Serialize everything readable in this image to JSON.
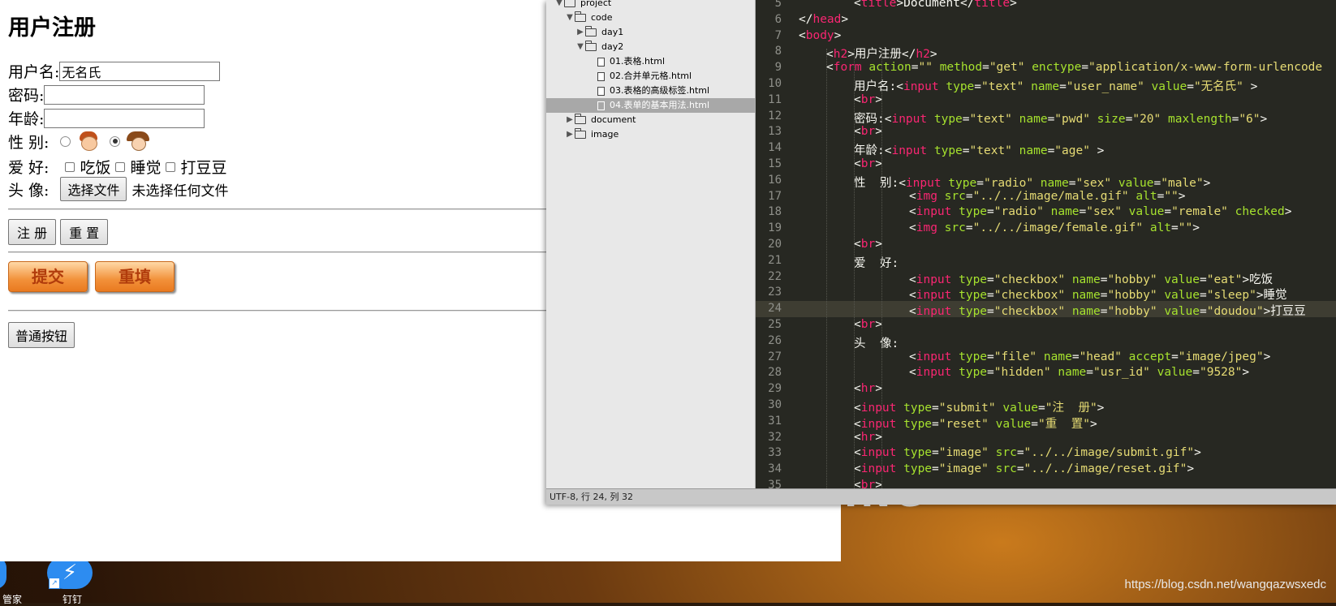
{
  "browser": {
    "title": "用户注册",
    "username_label": "用户名:",
    "username_value": "无名氏",
    "password_label": "密码:",
    "age_label": "年龄:",
    "gender_label": "性 别:",
    "hobby_label": "爱 好:",
    "hobbies": [
      "吃饭",
      "睡觉",
      "打豆豆"
    ],
    "avatar_label": "头 像:",
    "file_button": "选择文件",
    "file_status": "未选择任何文件",
    "submit_button": "注 册",
    "reset_button": "重 置",
    "image_submit": "提交",
    "image_reset": "重填",
    "plain_button": "普通按钮"
  },
  "file_tree": {
    "items": [
      {
        "label": "project",
        "type": "folder-open",
        "level": 0
      },
      {
        "label": "code",
        "type": "folder-open",
        "level": 1
      },
      {
        "label": "day1",
        "type": "folder",
        "level": 2
      },
      {
        "label": "day2",
        "type": "folder-open",
        "level": 2
      },
      {
        "label": "01.表格.html",
        "type": "file",
        "level": 3
      },
      {
        "label": "02.合并单元格.html",
        "type": "file",
        "level": 3
      },
      {
        "label": "03.表格的高级标签.html",
        "type": "file",
        "level": 3
      },
      {
        "label": "04.表单的基本用法.html",
        "type": "file",
        "level": 3,
        "selected": true
      },
      {
        "label": "document",
        "type": "folder",
        "level": 1
      },
      {
        "label": "image",
        "type": "folder",
        "level": 1
      }
    ]
  },
  "editor": {
    "line_numbers": [
      5,
      6,
      7,
      8,
      9,
      10,
      11,
      12,
      13,
      14,
      15,
      16,
      17,
      18,
      19,
      20,
      21,
      22,
      23,
      24,
      25,
      26,
      27,
      28,
      29,
      30,
      31,
      32,
      33,
      34,
      35
    ],
    "current_line": 24,
    "status": "UTF-8, 行 24, 列 32",
    "lines": [
      [
        {
          "c": "p",
          "t": "<"
        },
        {
          "c": "t",
          "t": "title"
        },
        {
          "c": "p",
          "t": ">Document</"
        },
        {
          "c": "t",
          "t": "title"
        },
        {
          "c": "p",
          "t": ">"
        }
      ],
      [
        {
          "c": "p",
          "t": "</"
        },
        {
          "c": "t",
          "t": "head"
        },
        {
          "c": "p",
          "t": ">"
        }
      ],
      [
        {
          "c": "p",
          "t": "<"
        },
        {
          "c": "t",
          "t": "body"
        },
        {
          "c": "p",
          "t": ">"
        }
      ],
      [
        {
          "c": "p",
          "t": "<"
        },
        {
          "c": "t",
          "t": "h2"
        },
        {
          "c": "p",
          "t": ">用户注册</"
        },
        {
          "c": "t",
          "t": "h2"
        },
        {
          "c": "p",
          "t": ">"
        }
      ],
      [
        {
          "c": "p",
          "t": "<"
        },
        {
          "c": "t",
          "t": "form"
        },
        {
          "c": "a",
          "t": " action"
        },
        {
          "c": "p",
          "t": "="
        },
        {
          "c": "s",
          "t": "\"\""
        },
        {
          "c": "a",
          "t": " method"
        },
        {
          "c": "p",
          "t": "="
        },
        {
          "c": "s",
          "t": "\"get\""
        },
        {
          "c": "a",
          "t": " enctype"
        },
        {
          "c": "p",
          "t": "="
        },
        {
          "c": "s",
          "t": "\"application/x-www-form-urlencode"
        }
      ],
      [
        {
          "c": "p",
          "t": "用户名:<"
        },
        {
          "c": "t",
          "t": "input"
        },
        {
          "c": "a",
          "t": " type"
        },
        {
          "c": "p",
          "t": "="
        },
        {
          "c": "s",
          "t": "\"text\""
        },
        {
          "c": "a",
          "t": " name"
        },
        {
          "c": "p",
          "t": "="
        },
        {
          "c": "s",
          "t": "\"user_name\""
        },
        {
          "c": "a",
          "t": " value"
        },
        {
          "c": "p",
          "t": "="
        },
        {
          "c": "s",
          "t": "\"无名氏\""
        },
        {
          "c": "p",
          "t": " >"
        }
      ],
      [
        {
          "c": "p",
          "t": "<"
        },
        {
          "c": "t",
          "t": "br"
        },
        {
          "c": "p",
          "t": ">"
        }
      ],
      [
        {
          "c": "p",
          "t": "密码:<"
        },
        {
          "c": "t",
          "t": "input"
        },
        {
          "c": "a",
          "t": " type"
        },
        {
          "c": "p",
          "t": "="
        },
        {
          "c": "s",
          "t": "\"text\""
        },
        {
          "c": "a",
          "t": " name"
        },
        {
          "c": "p",
          "t": "="
        },
        {
          "c": "s",
          "t": "\"pwd\""
        },
        {
          "c": "a",
          "t": " size"
        },
        {
          "c": "p",
          "t": "="
        },
        {
          "c": "s",
          "t": "\"20\""
        },
        {
          "c": "a",
          "t": " maxlength"
        },
        {
          "c": "p",
          "t": "="
        },
        {
          "c": "s",
          "t": "\"6\""
        },
        {
          "c": "p",
          "t": ">"
        }
      ],
      [
        {
          "c": "p",
          "t": "<"
        },
        {
          "c": "t",
          "t": "br"
        },
        {
          "c": "p",
          "t": ">"
        }
      ],
      [
        {
          "c": "p",
          "t": "年龄:<"
        },
        {
          "c": "t",
          "t": "input"
        },
        {
          "c": "a",
          "t": " type"
        },
        {
          "c": "p",
          "t": "="
        },
        {
          "c": "s",
          "t": "\"text\""
        },
        {
          "c": "a",
          "t": " name"
        },
        {
          "c": "p",
          "t": "="
        },
        {
          "c": "s",
          "t": "\"age\""
        },
        {
          "c": "p",
          "t": " >"
        }
      ],
      [
        {
          "c": "p",
          "t": "<"
        },
        {
          "c": "t",
          "t": "br"
        },
        {
          "c": "p",
          "t": ">"
        }
      ],
      [
        {
          "c": "p",
          "t": "性  别:<"
        },
        {
          "c": "t",
          "t": "input"
        },
        {
          "c": "a",
          "t": " type"
        },
        {
          "c": "p",
          "t": "="
        },
        {
          "c": "s",
          "t": "\"radio\""
        },
        {
          "c": "a",
          "t": " name"
        },
        {
          "c": "p",
          "t": "="
        },
        {
          "c": "s",
          "t": "\"sex\""
        },
        {
          "c": "a",
          "t": " value"
        },
        {
          "c": "p",
          "t": "="
        },
        {
          "c": "s",
          "t": "\"male\""
        },
        {
          "c": "p",
          "t": ">"
        }
      ],
      [
        {
          "c": "p",
          "t": "<"
        },
        {
          "c": "t",
          "t": "img"
        },
        {
          "c": "a",
          "t": " src"
        },
        {
          "c": "p",
          "t": "="
        },
        {
          "c": "s",
          "t": "\"../../image/male.gif\""
        },
        {
          "c": "a",
          "t": " alt"
        },
        {
          "c": "p",
          "t": "="
        },
        {
          "c": "s",
          "t": "\"\""
        },
        {
          "c": "p",
          "t": ">"
        }
      ],
      [
        {
          "c": "p",
          "t": "<"
        },
        {
          "c": "t",
          "t": "input"
        },
        {
          "c": "a",
          "t": " type"
        },
        {
          "c": "p",
          "t": "="
        },
        {
          "c": "s",
          "t": "\"radio\""
        },
        {
          "c": "a",
          "t": " name"
        },
        {
          "c": "p",
          "t": "="
        },
        {
          "c": "s",
          "t": "\"sex\""
        },
        {
          "c": "a",
          "t": " value"
        },
        {
          "c": "p",
          "t": "="
        },
        {
          "c": "s",
          "t": "\"remale\""
        },
        {
          "c": "a",
          "t": " checked"
        },
        {
          "c": "p",
          "t": ">"
        }
      ],
      [
        {
          "c": "p",
          "t": "<"
        },
        {
          "c": "t",
          "t": "img"
        },
        {
          "c": "a",
          "t": " src"
        },
        {
          "c": "p",
          "t": "="
        },
        {
          "c": "s",
          "t": "\"../../image/female.gif\""
        },
        {
          "c": "a",
          "t": " alt"
        },
        {
          "c": "p",
          "t": "="
        },
        {
          "c": "s",
          "t": "\"\""
        },
        {
          "c": "p",
          "t": ">"
        }
      ],
      [
        {
          "c": "p",
          "t": "<"
        },
        {
          "c": "t",
          "t": "br"
        },
        {
          "c": "p",
          "t": ">"
        }
      ],
      [
        {
          "c": "p",
          "t": "爱  好:"
        }
      ],
      [
        {
          "c": "p",
          "t": "<"
        },
        {
          "c": "t",
          "t": "input"
        },
        {
          "c": "a",
          "t": " type"
        },
        {
          "c": "p",
          "t": "="
        },
        {
          "c": "s",
          "t": "\"checkbox\""
        },
        {
          "c": "a",
          "t": " name"
        },
        {
          "c": "p",
          "t": "="
        },
        {
          "c": "s",
          "t": "\"hobby\""
        },
        {
          "c": "a",
          "t": " value"
        },
        {
          "c": "p",
          "t": "="
        },
        {
          "c": "s",
          "t": "\"eat\""
        },
        {
          "c": "p",
          "t": ">吃饭"
        }
      ],
      [
        {
          "c": "p",
          "t": "<"
        },
        {
          "c": "t",
          "t": "input"
        },
        {
          "c": "a",
          "t": " type"
        },
        {
          "c": "p",
          "t": "="
        },
        {
          "c": "s",
          "t": "\"checkbox\""
        },
        {
          "c": "a",
          "t": " name"
        },
        {
          "c": "p",
          "t": "="
        },
        {
          "c": "s",
          "t": "\"hobby\""
        },
        {
          "c": "a",
          "t": " value"
        },
        {
          "c": "p",
          "t": "="
        },
        {
          "c": "s",
          "t": "\"sleep\""
        },
        {
          "c": "p",
          "t": ">睡觉"
        }
      ],
      [
        {
          "c": "p",
          "t": "<"
        },
        {
          "c": "t",
          "t": "input"
        },
        {
          "c": "a",
          "t": " type"
        },
        {
          "c": "p",
          "t": "="
        },
        {
          "c": "s",
          "t": "\"checkbox\""
        },
        {
          "c": "a",
          "t": " name"
        },
        {
          "c": "p",
          "t": "="
        },
        {
          "c": "s",
          "t": "\"hobby\""
        },
        {
          "c": "a",
          "t": " value"
        },
        {
          "c": "p",
          "t": "="
        },
        {
          "c": "s",
          "t": "\"doudou\""
        },
        {
          "c": "p",
          "t": ">打豆豆"
        }
      ],
      [
        {
          "c": "p",
          "t": "<"
        },
        {
          "c": "t",
          "t": "br"
        },
        {
          "c": "p",
          "t": ">"
        }
      ],
      [
        {
          "c": "p",
          "t": "头  像:"
        }
      ],
      [
        {
          "c": "p",
          "t": "<"
        },
        {
          "c": "t",
          "t": "input"
        },
        {
          "c": "a",
          "t": " type"
        },
        {
          "c": "p",
          "t": "="
        },
        {
          "c": "s",
          "t": "\"file\""
        },
        {
          "c": "a",
          "t": " name"
        },
        {
          "c": "p",
          "t": "="
        },
        {
          "c": "s",
          "t": "\"head\""
        },
        {
          "c": "a",
          "t": " accept"
        },
        {
          "c": "p",
          "t": "="
        },
        {
          "c": "s",
          "t": "\"image/jpeg\""
        },
        {
          "c": "p",
          "t": ">"
        }
      ],
      [
        {
          "c": "p",
          "t": "<"
        },
        {
          "c": "t",
          "t": "input"
        },
        {
          "c": "a",
          "t": " type"
        },
        {
          "c": "p",
          "t": "="
        },
        {
          "c": "s",
          "t": "\"hidden\""
        },
        {
          "c": "a",
          "t": " name"
        },
        {
          "c": "p",
          "t": "="
        },
        {
          "c": "s",
          "t": "\"usr_id\""
        },
        {
          "c": "a",
          "t": " value"
        },
        {
          "c": "p",
          "t": "="
        },
        {
          "c": "s",
          "t": "\"9528\""
        },
        {
          "c": "p",
          "t": ">"
        }
      ],
      [
        {
          "c": "p",
          "t": "<"
        },
        {
          "c": "t",
          "t": "hr"
        },
        {
          "c": "p",
          "t": ">"
        }
      ],
      [
        {
          "c": "p",
          "t": "<"
        },
        {
          "c": "t",
          "t": "input"
        },
        {
          "c": "a",
          "t": " type"
        },
        {
          "c": "p",
          "t": "="
        },
        {
          "c": "s",
          "t": "\"submit\""
        },
        {
          "c": "a",
          "t": " value"
        },
        {
          "c": "p",
          "t": "="
        },
        {
          "c": "s",
          "t": "\"注  册\""
        },
        {
          "c": "p",
          "t": ">"
        }
      ],
      [
        {
          "c": "p",
          "t": "<"
        },
        {
          "c": "t",
          "t": "input"
        },
        {
          "c": "a",
          "t": " type"
        },
        {
          "c": "p",
          "t": "="
        },
        {
          "c": "s",
          "t": "\"reset\""
        },
        {
          "c": "a",
          "t": " value"
        },
        {
          "c": "p",
          "t": "="
        },
        {
          "c": "s",
          "t": "\"重  置\""
        },
        {
          "c": "p",
          "t": ">"
        }
      ],
      [
        {
          "c": "p",
          "t": "<"
        },
        {
          "c": "t",
          "t": "hr"
        },
        {
          "c": "p",
          "t": ">"
        }
      ],
      [
        {
          "c": "p",
          "t": "<"
        },
        {
          "c": "t",
          "t": "input"
        },
        {
          "c": "a",
          "t": " type"
        },
        {
          "c": "p",
          "t": "="
        },
        {
          "c": "s",
          "t": "\"image\""
        },
        {
          "c": "a",
          "t": " src"
        },
        {
          "c": "p",
          "t": "="
        },
        {
          "c": "s",
          "t": "\"../../image/submit.gif\""
        },
        {
          "c": "p",
          "t": ">"
        }
      ],
      [
        {
          "c": "p",
          "t": "<"
        },
        {
          "c": "t",
          "t": "input"
        },
        {
          "c": "a",
          "t": " type"
        },
        {
          "c": "p",
          "t": "="
        },
        {
          "c": "s",
          "t": "\"image\""
        },
        {
          "c": "a",
          "t": " src"
        },
        {
          "c": "p",
          "t": "="
        },
        {
          "c": "s",
          "t": "\"../../image/reset.gif\""
        },
        {
          "c": "p",
          "t": ">"
        }
      ],
      [
        {
          "c": "p",
          "t": "<"
        },
        {
          "c": "t",
          "t": "br"
        },
        {
          "c": "p",
          "t": ">"
        }
      ]
    ]
  },
  "desktop": {
    "watermark": "https://blog.csdn.net/wangqazwsxedc",
    "icon_labels": [
      "管家",
      "钉钉"
    ]
  },
  "colors": {
    "tag": "#f92672",
    "attr": "#a6e22e",
    "string": "#e6db74",
    "plain": "#f8f8f2",
    "editor_bg": "#272822"
  }
}
